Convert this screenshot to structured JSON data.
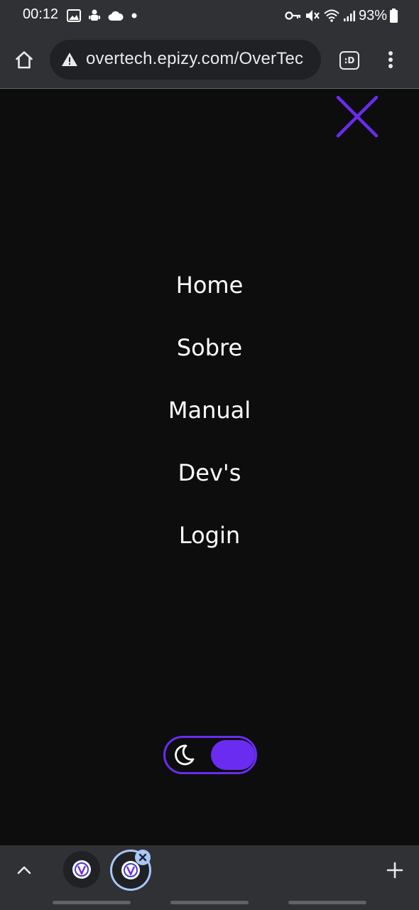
{
  "status_bar": {
    "time": "00:12",
    "battery_text": "93%",
    "left_icons": [
      "gallery-icon",
      "android-notification-icon",
      "cloud-icon",
      "dot-icon"
    ],
    "right_icons": [
      "key-icon",
      "mute-icon",
      "wifi-icon",
      "signal-icon",
      "battery-icon"
    ]
  },
  "browser": {
    "url": "overtech.epizy.com/OverTec",
    "security_icon": "warning-triangle-icon",
    "extension_label": ":D"
  },
  "page": {
    "nav_items": [
      {
        "label": "Home"
      },
      {
        "label": "Sobre"
      },
      {
        "label": "Manual"
      },
      {
        "label": "Dev's"
      },
      {
        "label": "Login"
      }
    ],
    "theme_toggle": {
      "mode": "dark",
      "icon": "moon-icon"
    }
  },
  "tabs": {
    "count": 2,
    "active_index": 1
  },
  "colors": {
    "accent": "#6A2CF0",
    "page_background": "#0D0D0D",
    "chrome_background": "#303134",
    "omnibox_background": "#202124",
    "active_tab_ring": "#A8C7FA"
  }
}
